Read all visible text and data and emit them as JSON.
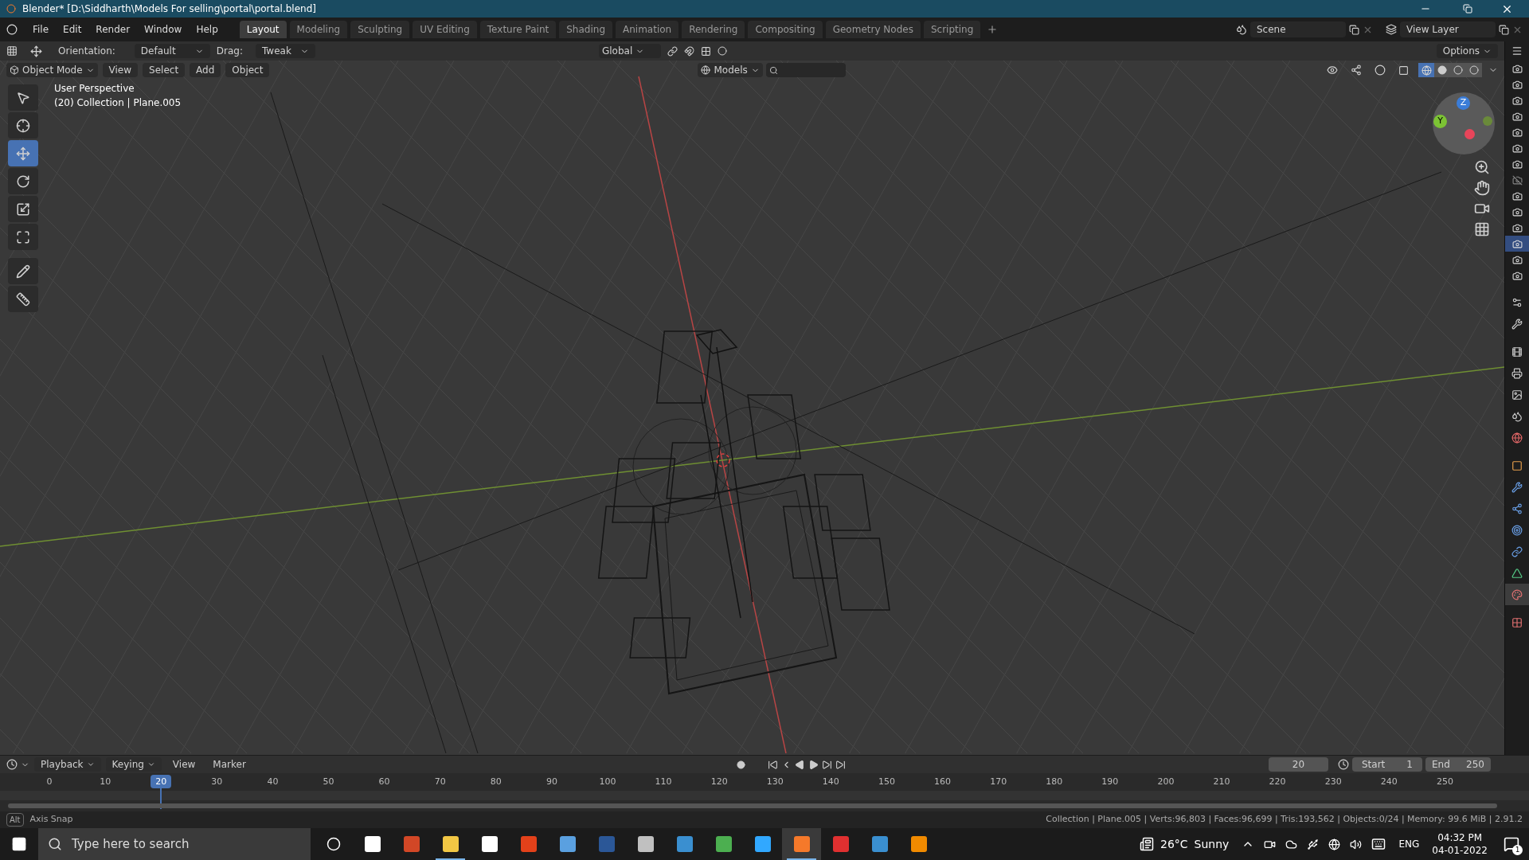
{
  "window": {
    "title": "Blender* [D:\\Siddharth\\Models For selling\\portal\\portal.blend]"
  },
  "menu": [
    "File",
    "Edit",
    "Render",
    "Window",
    "Help"
  ],
  "workspaces": [
    {
      "label": "Layout",
      "selected": true
    },
    {
      "label": "Modeling",
      "selected": false
    },
    {
      "label": "Sculpting",
      "selected": false
    },
    {
      "label": "UV Editing",
      "selected": false
    },
    {
      "label": "Texture Paint",
      "selected": false
    },
    {
      "label": "Shading",
      "selected": false
    },
    {
      "label": "Animation",
      "selected": false
    },
    {
      "label": "Rendering",
      "selected": false
    },
    {
      "label": "Compositing",
      "selected": false
    },
    {
      "label": "Geometry Nodes",
      "selected": false
    },
    {
      "label": "Scripting",
      "selected": false
    }
  ],
  "scene": {
    "value": "Scene"
  },
  "view_layer": {
    "value": "View Layer"
  },
  "tool_header": {
    "orientation_label": "Orientation:",
    "orientation": "Default",
    "drag_label": "Drag:",
    "drag": "Tweak",
    "transform_orientation": "Global",
    "options": "Options"
  },
  "viewport_header": {
    "mode": "Object Mode",
    "menus": [
      "View",
      "Select",
      "Add",
      "Object"
    ],
    "filter": "Models"
  },
  "shading_modes": [
    {
      "selected": true
    },
    {
      "selected": false
    },
    {
      "selected": false
    },
    {
      "selected": false
    }
  ],
  "viewport_info": [
    "User Perspective",
    "(20) Collection | Plane.005"
  ],
  "gizmo": {
    "labels": [
      "Z",
      "Y"
    ]
  },
  "tools": [
    {
      "selected": false
    },
    {
      "selected": false
    },
    {
      "selected": true
    },
    {
      "selected": false
    },
    {
      "selected": false
    },
    {
      "selected": false
    },
    {
      "selected": false
    },
    {
      "selected": false
    }
  ],
  "outliner_cameras": [
    {
      "visible": true,
      "selected": false
    },
    {
      "visible": true,
      "selected": false
    },
    {
      "visible": true,
      "selected": false
    },
    {
      "visible": true,
      "selected": false
    },
    {
      "visible": true,
      "selected": false
    },
    {
      "visible": true,
      "selected": false
    },
    {
      "visible": true,
      "selected": false
    },
    {
      "visible": false,
      "selected": false
    },
    {
      "visible": true,
      "selected": false
    },
    {
      "visible": true,
      "selected": false
    },
    {
      "visible": true,
      "selected": false
    },
    {
      "visible": true,
      "selected": true
    },
    {
      "visible": true,
      "selected": false
    },
    {
      "visible": true,
      "selected": false
    }
  ],
  "property_tabs": [
    {
      "selected": false
    },
    {
      "selected": false
    },
    {
      "selected": false
    },
    {
      "selected": false
    },
    {
      "selected": false
    },
    {
      "selected": false
    },
    {
      "selected": false
    },
    {
      "selected": false
    },
    {
      "selected": false
    },
    {
      "selected": false
    },
    {
      "selected": false
    },
    {
      "selected": false
    },
    {
      "selected": false
    },
    {
      "selected": true
    },
    {
      "selected": false
    }
  ],
  "timeline": {
    "menus": [
      "Playback",
      "Keying",
      "View",
      "Marker"
    ],
    "current_frame": "20",
    "start_label": "Start",
    "start": "1",
    "end_label": "End",
    "end": "250",
    "ticks": [
      {
        "kind": "tick",
        "label": "0"
      },
      {
        "kind": "tick",
        "label": "10"
      },
      {
        "kind": "playhead",
        "label": "20"
      },
      {
        "kind": "tick",
        "label": "30"
      },
      {
        "kind": "tick",
        "label": "40"
      },
      {
        "kind": "tick",
        "label": "50"
      },
      {
        "kind": "tick",
        "label": "60"
      },
      {
        "kind": "tick",
        "label": "70"
      },
      {
        "kind": "tick",
        "label": "80"
      },
      {
        "kind": "tick",
        "label": "90"
      },
      {
        "kind": "tick",
        "label": "100"
      },
      {
        "kind": "tick",
        "label": "110"
      },
      {
        "kind": "tick",
        "label": "120"
      },
      {
        "kind": "tick",
        "label": "130"
      },
      {
        "kind": "tick",
        "label": "140"
      },
      {
        "kind": "tick",
        "label": "150"
      },
      {
        "kind": "tick",
        "label": "160"
      },
      {
        "kind": "tick",
        "label": "170"
      },
      {
        "kind": "tick",
        "label": "180"
      },
      {
        "kind": "tick",
        "label": "190"
      },
      {
        "kind": "tick",
        "label": "200"
      },
      {
        "kind": "tick",
        "label": "210"
      },
      {
        "kind": "tick",
        "label": "220"
      },
      {
        "kind": "tick",
        "label": "230"
      },
      {
        "kind": "tick",
        "label": "240"
      },
      {
        "kind": "tick",
        "label": "250"
      }
    ]
  },
  "status_bar": {
    "key": "Alt",
    "hint": "Axis Snap",
    "stats": "Collection | Plane.005 | Verts:96,803 | Faces:96,699 | Tris:193,562 | Objects:0/24 | Memory: 99.6 MiB | 2.91.2"
  },
  "taskbar": {
    "search_placeholder": "Type here to search",
    "apps": [
      {
        "running": false,
        "selected": false
      },
      {
        "running": false,
        "selected": false
      },
      {
        "running": false,
        "selected": false
      },
      {
        "running": true,
        "selected": false
      },
      {
        "running": false,
        "selected": false
      },
      {
        "running": false,
        "selected": false
      },
      {
        "running": false,
        "selected": false
      },
      {
        "running": false,
        "selected": false
      },
      {
        "running": false,
        "selected": false
      },
      {
        "running": false,
        "selected": false
      },
      {
        "running": false,
        "selected": false
      },
      {
        "running": false,
        "selected": false
      },
      {
        "running": true,
        "selected": true
      },
      {
        "running": false,
        "selected": false
      },
      {
        "running": false,
        "selected": false
      },
      {
        "running": false,
        "selected": false
      }
    ],
    "temperature": "26°C",
    "weather": "Sunny",
    "language": "ENG",
    "time": "04:32 PM",
    "date": "04-01-2022",
    "notifications": "1"
  }
}
